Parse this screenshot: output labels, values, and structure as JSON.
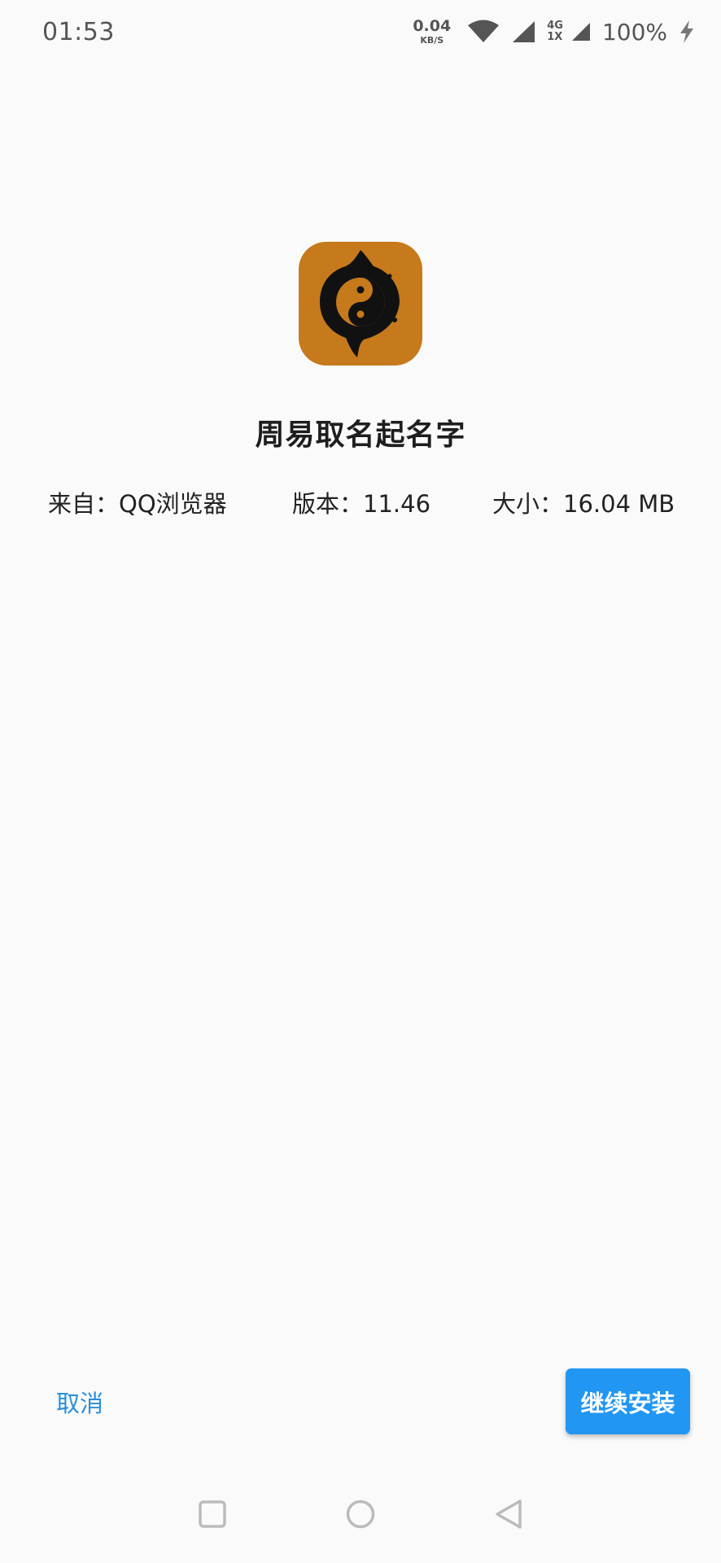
{
  "status_bar": {
    "time": "01:53",
    "net_speed_value": "0.04",
    "net_speed_unit": "KB/S",
    "net_type_top": "4G",
    "net_type_bottom": "1X",
    "battery": "100%"
  },
  "app": {
    "name": "周易取名起名字",
    "icon": "yin-yang-icon",
    "source": "来自：QQ浏览器",
    "version": "版本：11.46",
    "size": "大小：16.04 MB"
  },
  "actions": {
    "cancel_label": "取消",
    "install_label": "继续安装"
  },
  "nav": {
    "recent_icon": "square-icon",
    "home_icon": "circle-icon",
    "back_icon": "triangle-back-icon"
  },
  "colors": {
    "accent": "#2196f3",
    "cancel_text": "#2a8fd8",
    "icon_background": "#c67a1c"
  }
}
